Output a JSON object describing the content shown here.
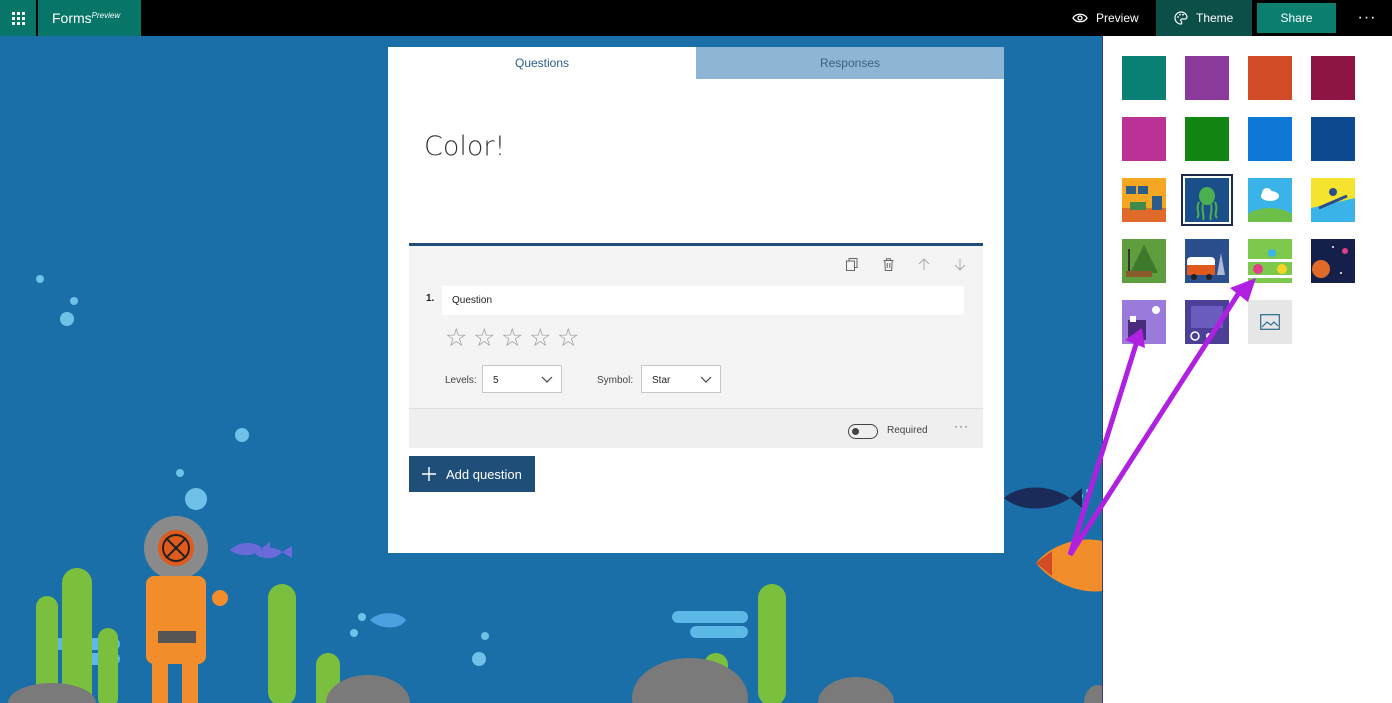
{
  "topbar": {
    "brand": "Forms",
    "brand_sub": "Preview",
    "preview_label": "Preview",
    "theme_label": "Theme",
    "share_label": "Share",
    "more_label": "···"
  },
  "form": {
    "tabs": [
      {
        "label": "Questions",
        "active": true
      },
      {
        "label": "Responses",
        "active": false
      }
    ],
    "title": "Color!",
    "question": {
      "number": "1.",
      "text": "Question",
      "rating_symbols": [
        "☆",
        "☆",
        "☆",
        "☆",
        "☆"
      ],
      "levels_label": "Levels:",
      "levels_value": "5",
      "symbol_label": "Symbol:",
      "symbol_value": "Star",
      "required_label": "Required",
      "more_label": "···"
    },
    "add_question_label": "Add question"
  },
  "theme_panel": {
    "colors": [
      {
        "color": "#0a7f74",
        "name": "teal"
      },
      {
        "color": "#8b3a9b",
        "name": "purple"
      },
      {
        "color": "#d04b26",
        "name": "orange"
      },
      {
        "color": "#8e1443",
        "name": "maroon"
      },
      {
        "color": "#bb3296",
        "name": "magenta"
      },
      {
        "color": "#128512",
        "name": "green"
      },
      {
        "color": "#0e78d6",
        "name": "blue"
      },
      {
        "color": "#0d4a8f",
        "name": "navy"
      }
    ],
    "images": [
      {
        "name": "room",
        "bg": "#f5a623"
      },
      {
        "name": "octopus",
        "bg": "#1b6fa8",
        "selected": true
      },
      {
        "name": "cloud",
        "bg": "#3ab4e8"
      },
      {
        "name": "snowboard",
        "bg": "#f6e32d"
      },
      {
        "name": "forest",
        "bg": "#7bbf4a"
      },
      {
        "name": "van",
        "bg": "#2b4e8c"
      },
      {
        "name": "lab",
        "bg": "#7cc94e"
      },
      {
        "name": "space",
        "bg": "#15204a"
      },
      {
        "name": "castle",
        "bg": "#9a7bdc"
      },
      {
        "name": "classroom",
        "bg": "#4b3f96"
      }
    ],
    "upload_icon": "image-icon"
  },
  "accent_colors": {
    "forms_green": "#077568",
    "primary_blue": "#1f4e79",
    "annotation_arrow": "#b020e0"
  }
}
